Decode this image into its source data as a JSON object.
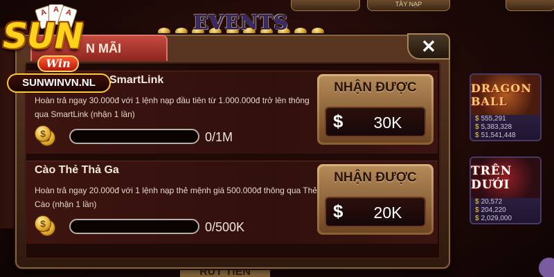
{
  "logo": {
    "brand": "SUN",
    "sub": "Win",
    "domain": "SUNWINVN.NL",
    "cards": [
      "A",
      "A",
      "A"
    ]
  },
  "background": {
    "top_tabs": [
      "",
      "TÂY NẠP"
    ],
    "cards": [
      {
        "title": "DRAGON BALL",
        "stats": [
          "555,291",
          "5,383,328",
          "51,541,448"
        ]
      },
      {
        "title": "TRÊN DƯỚI",
        "stats": [
          "20,572",
          "204,220",
          "2,029,000"
        ]
      }
    ],
    "bottom_button": "RÚT TIỀN"
  },
  "header": {
    "title": "EVENTS"
  },
  "modal": {
    "tab_label": "N MÃI",
    "close_symbol": "✕"
  },
  "events": [
    {
      "title": "SmartLink",
      "description": "Hoàn trả ngay 30.000đ với 1 lệnh nạp đầu tiên từ 1.000.000đ trở lên thông qua SmartLink (nhận 1 lần)",
      "progress_text": "0/1M",
      "progress_fraction": 0,
      "reward_label": "NHẬN ĐƯỢC",
      "reward_currency": "$",
      "reward_amount": "30K"
    },
    {
      "title": "Cào Thẻ Thả Ga",
      "description": "Hoàn trả ngay 20.000đ với 1 lệnh nạp thẻ mệnh giá 500.000đ thông qua Thẻ Cào (nhận 1 lần)",
      "progress_text": "0/500K",
      "progress_fraction": 0,
      "reward_label": "NHẬN ĐƯỢC",
      "reward_currency": "$",
      "reward_amount": "20K"
    }
  ],
  "colors": {
    "panel_bg": "#1f0907",
    "tab_red": "#c44a3f",
    "gold": "#ffd21c",
    "reward_gold": "#d9b07a"
  },
  "icons": [
    "coin-icon",
    "close-icon",
    "dollar-icon"
  ]
}
